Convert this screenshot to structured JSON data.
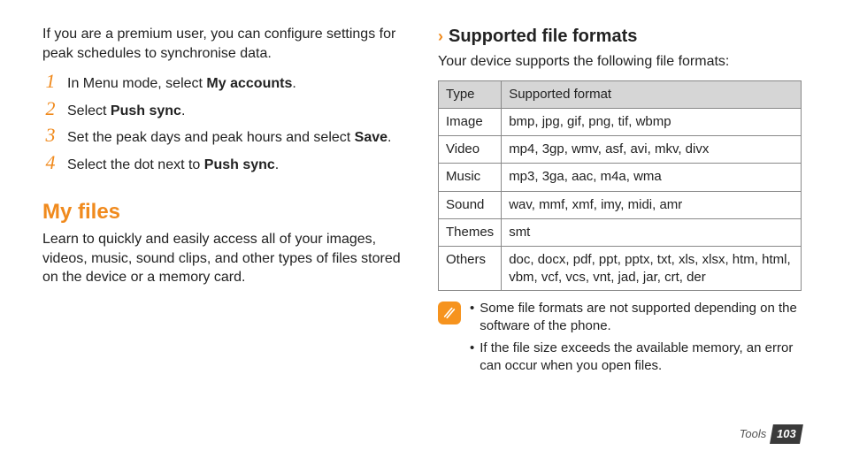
{
  "left": {
    "intro": "If you are a premium user, you can configure settings for peak schedules to synchronise data.",
    "steps": [
      {
        "num": "1",
        "pre": "In Menu mode, select ",
        "bold": "My accounts",
        "post": "."
      },
      {
        "num": "2",
        "pre": "Select ",
        "bold": "Push sync",
        "post": "."
      },
      {
        "num": "3",
        "pre": "Set the peak days and peak hours and select ",
        "bold": "Save",
        "post": "."
      },
      {
        "num": "4",
        "pre": "Select the dot next to ",
        "bold": "Push sync",
        "post": "."
      }
    ],
    "section_title": "My files",
    "section_body": "Learn to quickly and easily access all of your images, videos, music, sound clips, and other types of files stored on the device or a memory card."
  },
  "right": {
    "sub_title": "Supported file formats",
    "sub_intro": "Your device supports the following file formats:",
    "table": {
      "head": {
        "c1": "Type",
        "c2": "Supported format"
      },
      "rows": [
        {
          "c1": "Image",
          "c2": "bmp, jpg, gif, png, tif, wbmp"
        },
        {
          "c1": "Video",
          "c2": "mp4, 3gp, wmv, asf, avi, mkv, divx"
        },
        {
          "c1": "Music",
          "c2": "mp3, 3ga, aac, m4a, wma"
        },
        {
          "c1": "Sound",
          "c2": "wav, mmf, xmf, imy, midi, amr"
        },
        {
          "c1": "Themes",
          "c2": "smt"
        },
        {
          "c1": "Others",
          "c2": "doc, docx, pdf, ppt, pptx, txt, xls, xlsx, htm, html, vbm, vcf, vcs, vnt, jad, jar, crt, der"
        }
      ]
    },
    "notes": [
      "Some file formats are not supported depending on the software of the phone.",
      "If the file size exceeds the available memory, an error can occur when you open files."
    ]
  },
  "footer": {
    "section": "Tools",
    "page": "103"
  }
}
